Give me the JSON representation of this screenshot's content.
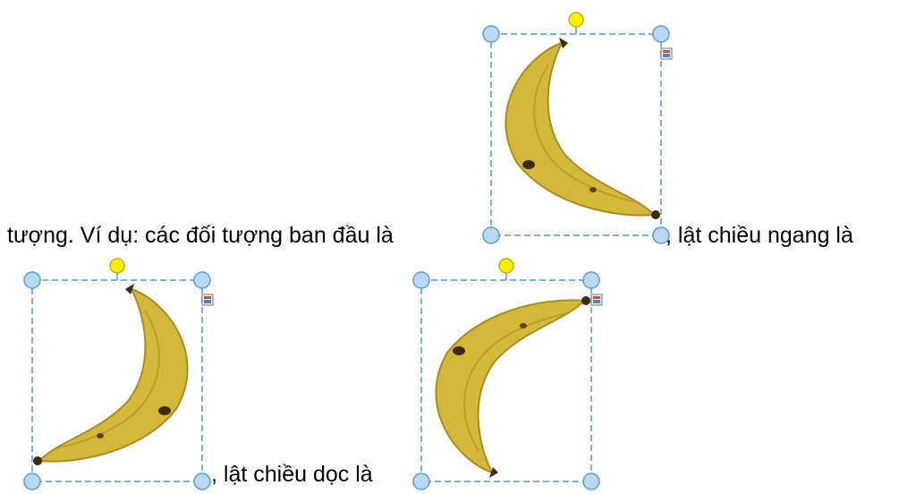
{
  "text": {
    "line1": "tượng. Ví dụ: các đối tượng ban đầu là",
    "line2": ", lật chiều ngang là",
    "line3": ", lật chiều dọc là"
  },
  "objects": [
    {
      "name": "original",
      "flip": "none"
    },
    {
      "name": "horizontal",
      "flip": "horizontal"
    },
    {
      "name": "vertical",
      "flip": "vertical"
    }
  ],
  "colors": {
    "selection_border": "#7ab3e0",
    "handle_fill": "#b9d9f3",
    "handle_stroke": "#5b9bd5",
    "rotate_handle": "#ffee00",
    "banana": "#d4b83a",
    "banana_shade": "#a98d1f",
    "banana_tip": "#3a2a10"
  }
}
